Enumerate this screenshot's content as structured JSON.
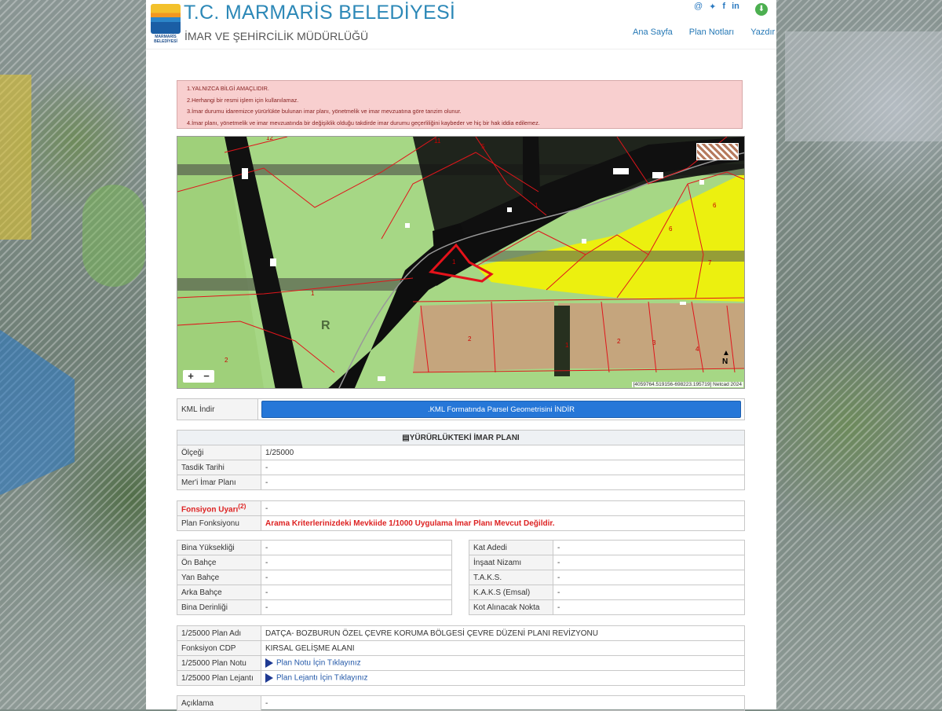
{
  "header": {
    "title": "T.C. MARMARİS BELEDİYESİ",
    "subtitle": "İMAR VE ŞEHİRCİLİK MÜDÜRLÜĞÜ",
    "logo_text": "MARMARİS BELEDİYESİ",
    "nav": [
      "Ana Sayfa",
      "Plan Notları",
      "Yazdır"
    ],
    "social_icons": [
      "at-icon",
      "twitter-icon",
      "facebook-icon",
      "linkedin-icon"
    ]
  },
  "warnings": [
    "1.YALNIZCA BİLGİ AMAÇLIDIR.",
    "2.Herhangi bir resmi işlem için kullanılamaz.",
    "3.İmar durumu idaremizce yürürlükte bulunan imar planı, yönetmelik ve imar mevzuatına göre tanzim olunur.",
    "4.İmar planı, yönetmelik ve imar mevzuatında bir değişiklik olduğu takdirde imar durumu geçerliliğini kaybeder ve hiç bir hak iddia edilemez."
  ],
  "map": {
    "zoom_in": "+",
    "zoom_out": "−",
    "coords": "[4059764.519156-698223.195719] Netcad 2024",
    "north": "N",
    "parcel_numbers": [
      "1",
      "2",
      "1",
      "2",
      "3",
      "4",
      "6",
      "6",
      "7",
      "5",
      "11",
      "12",
      "1",
      "2",
      "1"
    ],
    "text_label": "R"
  },
  "kml": {
    "label": "KML İndir",
    "button": ".KML Formatında Parsel Geometrisini İNDİR"
  },
  "imar_plani": {
    "heading": "YÜRÜRLÜKTEKİ İMAR PLANI",
    "rows": [
      {
        "label": "Ölçeği",
        "value": "1/25000"
      },
      {
        "label": "Tasdik Tarihi",
        "value": "-"
      },
      {
        "label": "Mer'i İmar Planı",
        "value": "-"
      }
    ]
  },
  "fonksiyon": {
    "uyari_label": "Fonsiyon Uyarı",
    "uyari_sup": "(2)",
    "uyari_value": "-",
    "plan_label": "Plan Fonksiyonu",
    "plan_value": "Arama Kriterlerinizdeki Mevkiide 1/1000 Uygulama İmar Planı Mevcut Değildir."
  },
  "left_table": [
    {
      "label": "Bina Yüksekliği",
      "value": "-"
    },
    {
      "label": "Ön Bahçe",
      "value": "-"
    },
    {
      "label": "Yan Bahçe",
      "value": "-"
    },
    {
      "label": "Arka Bahçe",
      "value": "-"
    },
    {
      "label": "Bina Derinliği",
      "value": "-"
    }
  ],
  "right_table": [
    {
      "label": "Kat Adedi",
      "value": "-"
    },
    {
      "label": "İnşaat Nizamı",
      "value": "-"
    },
    {
      "label": "T.A.K.S.",
      "value": "-"
    },
    {
      "label": "K.A.K.S (Emsal)",
      "value": "-"
    },
    {
      "label": "Kot Alınacak Nokta",
      "value": "-"
    }
  ],
  "plan_info": {
    "rows": [
      {
        "label": "1/25000 Plan Adı",
        "value": "DATÇA- BOZBURUN ÖZEL ÇEVRE KORUMA BÖLGESİ ÇEVRE DÜZENİ PLANI REVİZYONU"
      },
      {
        "label": "Fonksiyon CDP",
        "value": "KIRSAL GELİŞME ALANI"
      }
    ],
    "links": [
      {
        "label": "1/25000 Plan Notu",
        "value": "Plan Notu İçin Tıklayınız"
      },
      {
        "label": "1/25000 Plan Lejantı",
        "value": "Plan Lejantı İçin Tıklayınız"
      }
    ]
  },
  "aciklama": {
    "label": "Açıklama",
    "value": "-"
  },
  "colors": {
    "title": "#2c88b7",
    "warning_bg": "#f8cfcf",
    "button": "#2677d8",
    "alert": "#dd2222"
  }
}
